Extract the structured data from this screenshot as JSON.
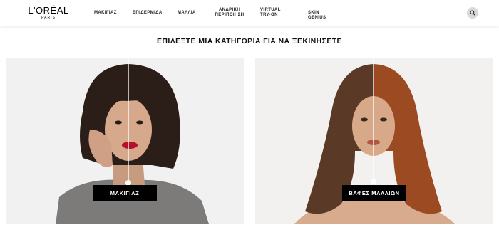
{
  "brand": {
    "name": "L'ORÉAL",
    "sub": "PARIS"
  },
  "nav": [
    {
      "label": "ΜΑΚΙΓΙΑΖ"
    },
    {
      "label": "ΕΠΙΔΕΡΜΙΔΑ"
    },
    {
      "label": "ΜΑΛΛΙΑ"
    },
    {
      "label": "ΑΝΔΡΙΚΗ ΠΕΡΙΠΟΙΗΣΗ"
    },
    {
      "label": "VIRTUAL TRY-ON"
    },
    {
      "label": "SKIN GENIUS"
    }
  ],
  "search": {
    "icon": "search-icon"
  },
  "heading": "ΕΠΙΛΕΞΤΕ ΜΙΑ ΚΑΤΗΓΟΡΙΑ ΓΙΑ ΝΑ ΞΕΚΙΝΗΣΕΤΕ",
  "cards": [
    {
      "button_label": "ΜΑΚΙΓΙΑΖ"
    },
    {
      "button_label": "ΒΑΦΕΣ ΜΑΛΛΙΩΝ"
    }
  ],
  "colors": {
    "cta_bg": "#000000",
    "search_bg": "#d8d8d8"
  }
}
